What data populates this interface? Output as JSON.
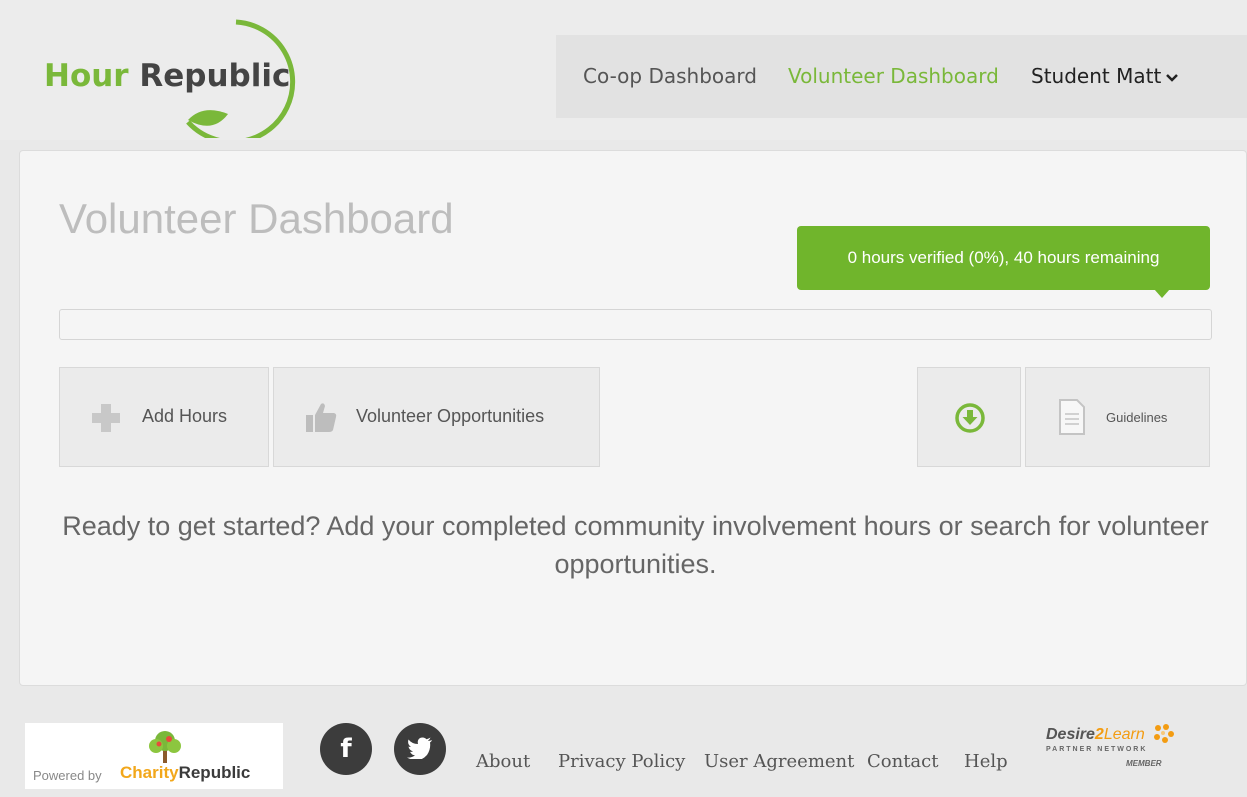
{
  "brand": {
    "hour": "Hour",
    "republic": "Republic",
    "accent_color": "#7ab83a"
  },
  "nav": {
    "coop": "Co-op Dashboard",
    "volunteer": "Volunteer Dashboard",
    "user": "Student Matt",
    "user_icon": "chevron-down-icon"
  },
  "main": {
    "title": "Volunteer Dashboard",
    "tooltip": "0 hours verified (0%), 40 hours remaining",
    "progress_percent": 0,
    "buttons": {
      "add_hours": "Add Hours",
      "opportunities": "Volunteer Opportunities",
      "download_icon": "download-icon",
      "guidelines": "Guidelines"
    },
    "message": "Ready to get started? Add your completed community involvement hours or search for volunteer opportunities."
  },
  "footer": {
    "powered_by": "Powered by",
    "charity": "Charity",
    "charity_republic": "Republic",
    "facebook_icon": "facebook-icon",
    "twitter_icon": "twitter-icon",
    "links": [
      "About",
      "Privacy Policy",
      "User Agreement",
      "Contact",
      "Help"
    ],
    "d2l": {
      "desire": "Desire",
      "two": "2",
      "learn": "Learn",
      "partner": "PARTNER NETWORK",
      "member": "MEMBER"
    }
  }
}
